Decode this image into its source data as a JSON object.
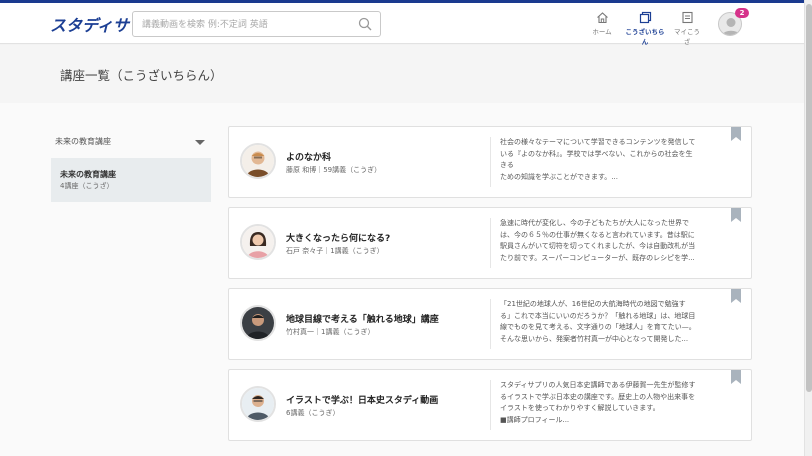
{
  "header": {
    "logo": "スタディサプリ",
    "search_placeholder": "講義動画を検索 例:不定詞 英語",
    "nav": [
      {
        "label": "ホーム",
        "icon": "home-icon"
      },
      {
        "label": "こうざいちらん",
        "icon": "course-list-icon"
      },
      {
        "label": "マイこうざ",
        "icon": "my-course-icon"
      }
    ],
    "notification_count": "2"
  },
  "page": {
    "title": "講座一覧（こうざいちらん）"
  },
  "sidebar": {
    "filter_label": "未来の教育講座",
    "items": [
      {
        "title": "未来の教育講座",
        "subtitle": "4講座（こうざ）"
      }
    ]
  },
  "courses": [
    {
      "title": "よのなか科",
      "meta": "藤原 和博｜59講義（こうぎ）",
      "desc": [
        "社会の様々なテーマについて学習できるコンテンツを発信して",
        "いる『よのなか科』。学校では学べない、これからの社会を生",
        "きる",
        "ための知識を学ぶことができます。..."
      ]
    },
    {
      "title": "大きくなったら何になる?",
      "meta": "石戸 奈々子｜1講義（こうぎ）",
      "desc": [
        "急速に時代が変化し、今の子どもたちが大人になった世界で",
        "は、今の６５％の仕事が無くなると言われています。昔は駅に",
        "駅員さんがいて切符を切ってくれましたが、今は自動改札が当",
        "たり前です。スーパーコンピューターが、既存のレシピを学..."
      ]
    },
    {
      "title": "地球目線で考える「触れる地球」講座",
      "meta": "竹村真一｜1講義（こうぎ）",
      "desc": [
        "「21世紀の地球人が、16世紀の大航海時代の地図で勉強す",
        "る」これで本当にいいのだろうか？「触れる地球」は、地球目",
        "線でものを見て考える、文字通りの「地球人」を育てたい—。",
        "そんな思いから、発案者竹村真一が中心となって開発した..."
      ]
    },
    {
      "title": "イラストで学ぶ！日本史スタディ動画",
      "meta": "6講義（こうぎ）",
      "desc": [
        "スタディサプリの人気日本史講師である伊藤賀一先生が監修す",
        "るイラストで学ぶ日本史の講座です。歴史上の人物や出来事を",
        "イラストを使ってわかりやすく解説していきます。",
        "■講師プロフィール..."
      ]
    }
  ],
  "colors": {
    "brand": "#1c3f94",
    "badge": "#d6328a"
  }
}
